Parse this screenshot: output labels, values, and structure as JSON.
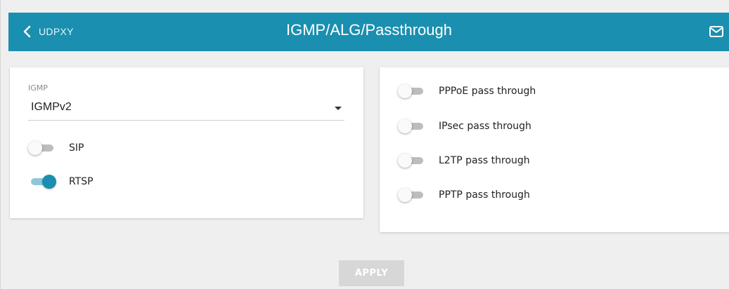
{
  "header": {
    "back_label": "UDPXY",
    "title": "IGMP/ALG/Passthrough",
    "back_icon": "chevron-left-icon",
    "mail_icon": "mail-icon"
  },
  "igmp": {
    "label": "IGMP",
    "value": "IGMPv2"
  },
  "alg_toggles": [
    {
      "label": "SIP",
      "on": false
    },
    {
      "label": "RTSP",
      "on": true
    }
  ],
  "passthrough_toggles": [
    {
      "label": "PPPoE pass through",
      "on": false
    },
    {
      "label": "IPsec pass through",
      "on": false
    },
    {
      "label": "L2TP pass through",
      "on": false
    },
    {
      "label": "PPTP pass through",
      "on": false
    }
  ],
  "apply_label": "APPLY",
  "colors": {
    "accent": "#1a8fb0",
    "background": "#efefef",
    "disabled_button": "#d7d7d7"
  }
}
